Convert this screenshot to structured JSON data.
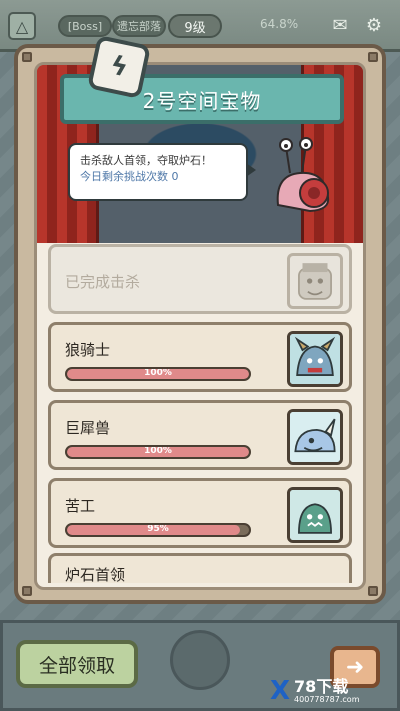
{
  "topbar": {
    "boss_tag": "[Boss]",
    "boss_name": "遗忘部落",
    "level": "9级",
    "percent": "64.8%",
    "icons": [
      "alert-triangle-icon",
      "mail-icon",
      "settings-gear-icon"
    ]
  },
  "panel": {
    "title": "2号空间宝物",
    "bubble": {
      "line1": "击杀敌人首领，夺取炉石！",
      "line2": "今日剩余挑战次数 0"
    }
  },
  "rows": [
    {
      "name": "已完成击杀",
      "done": true,
      "progress_text": "",
      "progress": null
    },
    {
      "name": "狼骑士",
      "done": false,
      "progress_text": "100%",
      "progress": 1.0
    },
    {
      "name": "巨犀兽",
      "done": false,
      "progress_text": "100%",
      "progress": 1.0
    },
    {
      "name": "苦工",
      "done": false,
      "progress_text": "95%",
      "progress": 0.95
    },
    {
      "name": "炉石首领",
      "done": false,
      "progress_text": "",
      "progress": null
    }
  ],
  "buttons": {
    "claim_all": "全部领取",
    "next_icon": "arrow-right-icon"
  },
  "watermark": {
    "brand": "78下载",
    "url": "400778787.com"
  },
  "colors": {
    "title_banner": "#6ab6ae",
    "progress_fill": "#e08a8a",
    "claim_button": "#bcd2a0",
    "next_button": "#e8b68e"
  }
}
